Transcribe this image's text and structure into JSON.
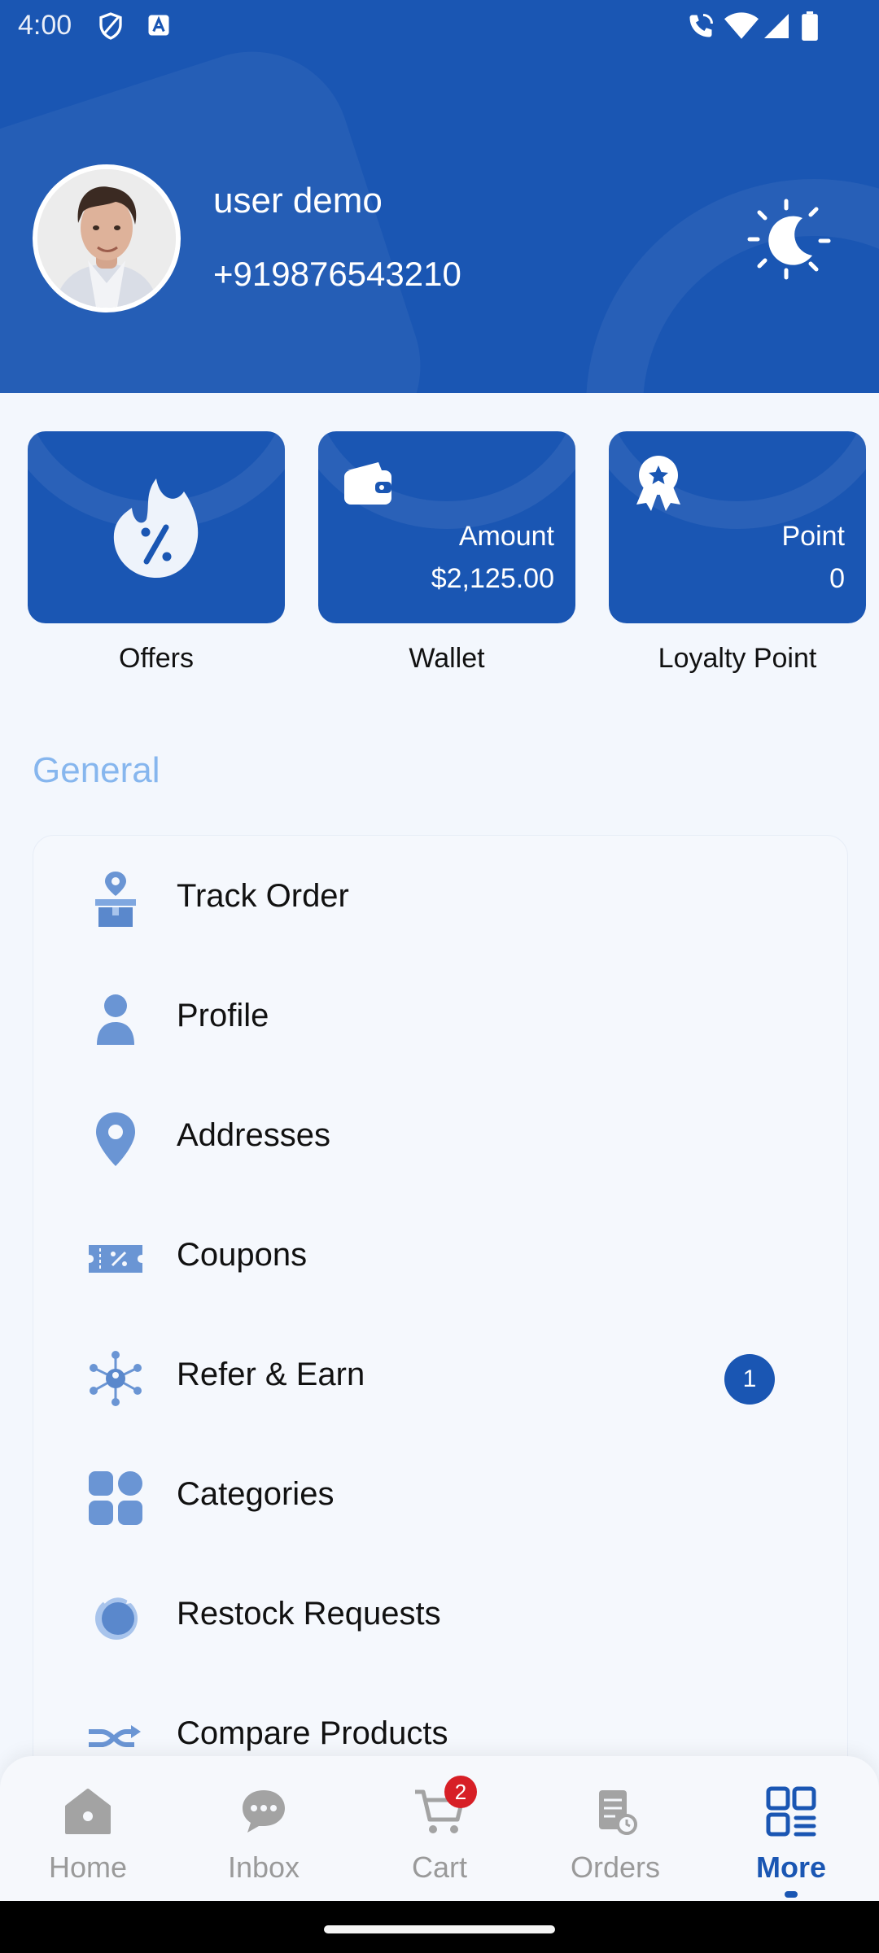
{
  "status_bar": {
    "time": "4:00"
  },
  "header": {
    "name": "user demo",
    "phone": "+919876543210"
  },
  "cards": [
    {
      "id": "offers",
      "caption": "Offers"
    },
    {
      "id": "wallet",
      "caption": "Wallet",
      "value_label": "Amount",
      "value": "$2,125.00"
    },
    {
      "id": "loyalty",
      "caption": "Loyalty Point",
      "value_label": "Point",
      "value": "0"
    }
  ],
  "section": {
    "title": "General"
  },
  "menu": [
    {
      "label": "Track Order",
      "icon": "track-order-icon"
    },
    {
      "label": "Profile",
      "icon": "user-icon"
    },
    {
      "label": "Addresses",
      "icon": "location-pin-icon"
    },
    {
      "label": "Coupons",
      "icon": "coupon-icon"
    },
    {
      "label": "Refer & Earn",
      "icon": "network-icon",
      "badge": "1"
    },
    {
      "label": "Categories",
      "icon": "categories-icon"
    },
    {
      "label": "Restock Requests",
      "icon": "restock-icon"
    },
    {
      "label": "Compare Products",
      "icon": "compare-icon"
    }
  ],
  "bottom_nav": {
    "items": [
      {
        "label": "Home",
        "icon": "home-icon"
      },
      {
        "label": "Inbox",
        "icon": "chat-icon"
      },
      {
        "label": "Cart",
        "icon": "cart-icon",
        "badge": "2"
      },
      {
        "label": "Orders",
        "icon": "orders-icon"
      },
      {
        "label": "More",
        "icon": "grid-menu-icon",
        "active": true
      }
    ]
  },
  "colors": {
    "primary": "#1a56b3",
    "background": "#f3f7fd",
    "section_title": "#86b6ee",
    "badge_red": "#d71f26"
  }
}
